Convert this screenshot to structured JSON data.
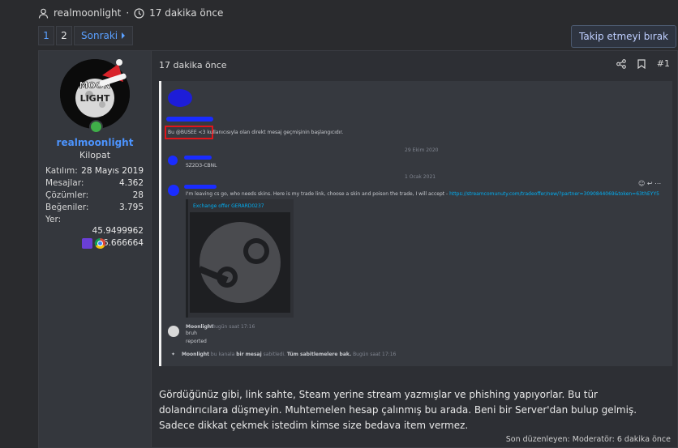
{
  "thread_meta": {
    "author": "realmoonlight",
    "separator": "·",
    "time": "17 dakika önce"
  },
  "pagination": {
    "pages": [
      "1",
      "2"
    ],
    "current": "1",
    "next_label": "Sonraki"
  },
  "follow_button": "Takip etmeyi bırak",
  "post": {
    "time": "17 dakika önce",
    "number": "#1",
    "message": "Gördüğünüz gibi, link sahte, Steam yerine stream yazmışlar ve phishing yapıyorlar. Bu tür dolandırıcılara düşmeyin. Muhtemelen hesap çalınmış bu arada. Beni bir Server'dan bulup gelmiş. Sadece dikkat çekmek istedim kimse size bedava item vermez.",
    "edited": "Son düzenleyen: Moderatör: 6 dakika önce"
  },
  "user": {
    "name": "realmoonlight",
    "title": "Kilopat",
    "avatar_text_1": "MOON",
    "avatar_text_2": "LIGHT",
    "stats": [
      {
        "label": "Katılım:",
        "value": "28 Mayıs 2019"
      },
      {
        "label": "Mesajlar:",
        "value": "4.362"
      },
      {
        "label": "Çözümler:",
        "value": "28"
      },
      {
        "label": "Beğeniler:",
        "value": "3.795"
      },
      {
        "label": "Yer:",
        "value": ""
      }
    ],
    "location": "45.9499962 -66.666664",
    "badges": [
      "windows-icon",
      "chrome-icon"
    ]
  },
  "screenshot": {
    "line1": "Bu @BUSEE <3 kullanıcısıyla olan direkt mesaj geçmişinin başlangıcıdır.",
    "date1": "29 Ekim 2020",
    "code": "SZ2D3-CBNL",
    "date2": "1 Ocak 2021",
    "scam_text": "I'm leaving cs go, who needs skins. Here is my trade link, choose a skin and poison the trade, I will accept -",
    "scam_link": "https://streamcomunuty.com/tradeoffer/new/?partner=3090844069&token=63thEYY5",
    "embed_title": "Exchange offer GERARD0237",
    "reply_name": "Moonlight",
    "reply_time": "Bugün saat 17:16",
    "reply_line1": "bruh",
    "reply_line2": "reported",
    "pin_name": "Moonlight",
    "pin_text": "bu kanala",
    "pin_bold": "bir mesaj",
    "pin_text2": "sabitledi.",
    "pin_link": "Tüm sabitlemelere bak.",
    "pin_time": "Bugün saat 17:16"
  },
  "colors": {
    "accent": "#4c94ff",
    "background": "#2a2b2e",
    "user_pane": "#34373d",
    "highlight_box": "#e0161b"
  }
}
